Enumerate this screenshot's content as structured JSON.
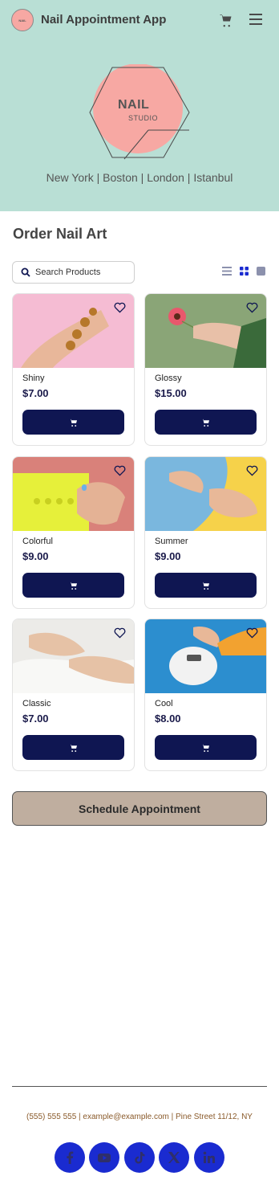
{
  "header": {
    "app_title": "Nail Appointment App",
    "logo_text": "NAIL"
  },
  "hero": {
    "logo_title": "NAIL",
    "logo_subtitle": "STUDIO",
    "cities": "New York | Boston | London | Istanbul"
  },
  "shop": {
    "title": "Order Nail Art",
    "search_placeholder": "Search Products",
    "products": [
      {
        "name": "Shiny",
        "price": "$7.00"
      },
      {
        "name": "Glossy",
        "price": "$15.00"
      },
      {
        "name": "Colorful",
        "price": "$9.00"
      },
      {
        "name": "Summer",
        "price": "$9.00"
      },
      {
        "name": "Classic",
        "price": "$7.00"
      },
      {
        "name": "Cool",
        "price": "$8.00"
      }
    ],
    "schedule_label": "Schedule Appointment"
  },
  "footer": {
    "contact": "(555) 555 555 | example@example.com | Pine Street 11/12, NY",
    "social": [
      "facebook-icon",
      "youtube-icon",
      "tiktok-icon",
      "x-icon",
      "linkedin-icon"
    ]
  },
  "colors": {
    "mint": "#b9dfd5",
    "navy": "#0f1652",
    "accent_blue": "#1a2bd0",
    "schedule_bg": "#bfae9f",
    "pink": "#f7a8a3"
  }
}
